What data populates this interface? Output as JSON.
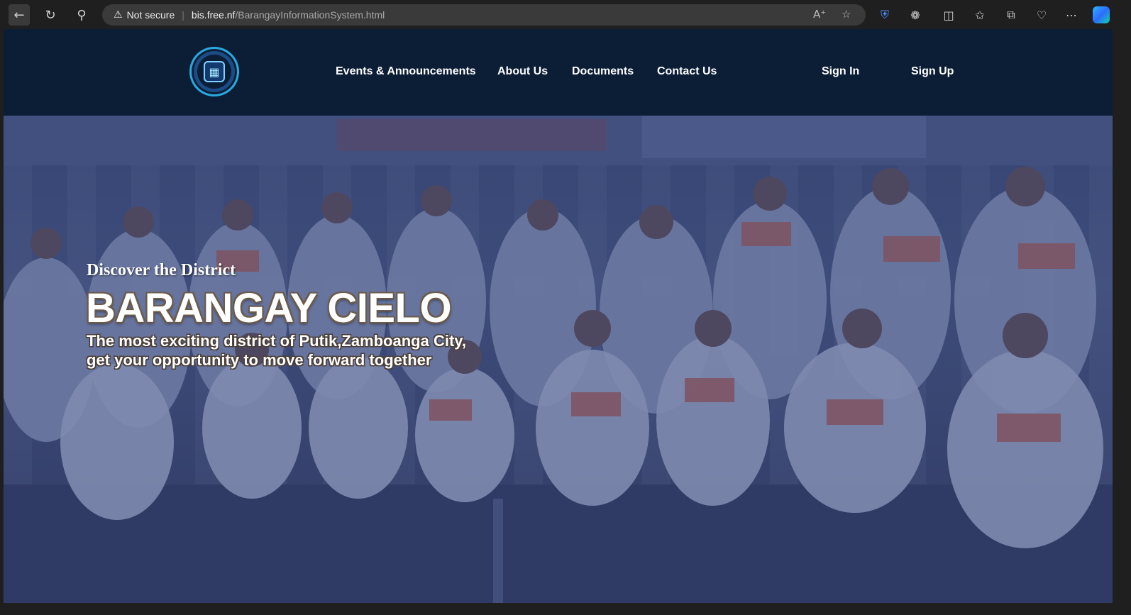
{
  "browser": {
    "back_icon": "arrow-left-icon",
    "reload_icon": "reload-icon",
    "search_icon": "search-icon",
    "security_label": "Not secure",
    "url_host": "bis.free.nf",
    "url_path": "/BarangayInformationSystem.html",
    "read_aloud_icon": "read-aloud-icon",
    "favorite_icon": "star-icon",
    "extensions": [
      "shield-extension-icon",
      "puzzle-extensions-icon",
      "split-screen-icon",
      "favorites-icon",
      "collections-icon",
      "performance-heart-icon",
      "more-options-icon",
      "copilot-icon"
    ]
  },
  "site": {
    "logo_icon": "barangay-seal-logo",
    "nav": [
      {
        "label": "Events & Announcements"
      },
      {
        "label": "About Us"
      },
      {
        "label": "Documents"
      },
      {
        "label": "Contact Us"
      }
    ],
    "auth": {
      "sign_in": "Sign In",
      "sign_up": "Sign Up"
    }
  },
  "hero": {
    "eyebrow": "Discover the District",
    "title": "BARANGAY CIELO",
    "tagline_line1": "The most exciting district of Putik,Zamboanga City,",
    "tagline_line2": "get your opportunity to move forward together",
    "background": "group-photo-of-residents"
  },
  "colors": {
    "header_bg": "#0c1d36",
    "hero_overlay": "#16245c",
    "text": "#ffffff"
  }
}
